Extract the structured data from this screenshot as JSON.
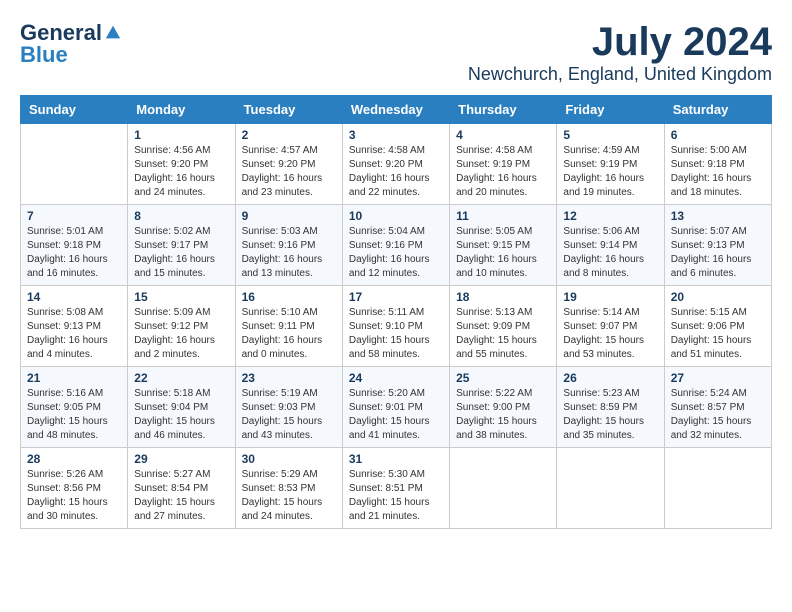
{
  "header": {
    "logo": {
      "general": "General",
      "blue": "Blue",
      "tagline": ""
    },
    "title": "July 2024",
    "location": "Newchurch, England, United Kingdom"
  },
  "calendar": {
    "weekdays": [
      "Sunday",
      "Monday",
      "Tuesday",
      "Wednesday",
      "Thursday",
      "Friday",
      "Saturday"
    ],
    "weeks": [
      [
        {
          "day": "",
          "sunrise": "",
          "sunset": "",
          "daylight": ""
        },
        {
          "day": "1",
          "sunrise": "Sunrise: 4:56 AM",
          "sunset": "Sunset: 9:20 PM",
          "daylight": "Daylight: 16 hours and 24 minutes."
        },
        {
          "day": "2",
          "sunrise": "Sunrise: 4:57 AM",
          "sunset": "Sunset: 9:20 PM",
          "daylight": "Daylight: 16 hours and 23 minutes."
        },
        {
          "day": "3",
          "sunrise": "Sunrise: 4:58 AM",
          "sunset": "Sunset: 9:20 PM",
          "daylight": "Daylight: 16 hours and 22 minutes."
        },
        {
          "day": "4",
          "sunrise": "Sunrise: 4:58 AM",
          "sunset": "Sunset: 9:19 PM",
          "daylight": "Daylight: 16 hours and 20 minutes."
        },
        {
          "day": "5",
          "sunrise": "Sunrise: 4:59 AM",
          "sunset": "Sunset: 9:19 PM",
          "daylight": "Daylight: 16 hours and 19 minutes."
        },
        {
          "day": "6",
          "sunrise": "Sunrise: 5:00 AM",
          "sunset": "Sunset: 9:18 PM",
          "daylight": "Daylight: 16 hours and 18 minutes."
        }
      ],
      [
        {
          "day": "7",
          "sunrise": "Sunrise: 5:01 AM",
          "sunset": "Sunset: 9:18 PM",
          "daylight": "Daylight: 16 hours and 16 minutes."
        },
        {
          "day": "8",
          "sunrise": "Sunrise: 5:02 AM",
          "sunset": "Sunset: 9:17 PM",
          "daylight": "Daylight: 16 hours and 15 minutes."
        },
        {
          "day": "9",
          "sunrise": "Sunrise: 5:03 AM",
          "sunset": "Sunset: 9:16 PM",
          "daylight": "Daylight: 16 hours and 13 minutes."
        },
        {
          "day": "10",
          "sunrise": "Sunrise: 5:04 AM",
          "sunset": "Sunset: 9:16 PM",
          "daylight": "Daylight: 16 hours and 12 minutes."
        },
        {
          "day": "11",
          "sunrise": "Sunrise: 5:05 AM",
          "sunset": "Sunset: 9:15 PM",
          "daylight": "Daylight: 16 hours and 10 minutes."
        },
        {
          "day": "12",
          "sunrise": "Sunrise: 5:06 AM",
          "sunset": "Sunset: 9:14 PM",
          "daylight": "Daylight: 16 hours and 8 minutes."
        },
        {
          "day": "13",
          "sunrise": "Sunrise: 5:07 AM",
          "sunset": "Sunset: 9:13 PM",
          "daylight": "Daylight: 16 hours and 6 minutes."
        }
      ],
      [
        {
          "day": "14",
          "sunrise": "Sunrise: 5:08 AM",
          "sunset": "Sunset: 9:13 PM",
          "daylight": "Daylight: 16 hours and 4 minutes."
        },
        {
          "day": "15",
          "sunrise": "Sunrise: 5:09 AM",
          "sunset": "Sunset: 9:12 PM",
          "daylight": "Daylight: 16 hours and 2 minutes."
        },
        {
          "day": "16",
          "sunrise": "Sunrise: 5:10 AM",
          "sunset": "Sunset: 9:11 PM",
          "daylight": "Daylight: 16 hours and 0 minutes."
        },
        {
          "day": "17",
          "sunrise": "Sunrise: 5:11 AM",
          "sunset": "Sunset: 9:10 PM",
          "daylight": "Daylight: 15 hours and 58 minutes."
        },
        {
          "day": "18",
          "sunrise": "Sunrise: 5:13 AM",
          "sunset": "Sunset: 9:09 PM",
          "daylight": "Daylight: 15 hours and 55 minutes."
        },
        {
          "day": "19",
          "sunrise": "Sunrise: 5:14 AM",
          "sunset": "Sunset: 9:07 PM",
          "daylight": "Daylight: 15 hours and 53 minutes."
        },
        {
          "day": "20",
          "sunrise": "Sunrise: 5:15 AM",
          "sunset": "Sunset: 9:06 PM",
          "daylight": "Daylight: 15 hours and 51 minutes."
        }
      ],
      [
        {
          "day": "21",
          "sunrise": "Sunrise: 5:16 AM",
          "sunset": "Sunset: 9:05 PM",
          "daylight": "Daylight: 15 hours and 48 minutes."
        },
        {
          "day": "22",
          "sunrise": "Sunrise: 5:18 AM",
          "sunset": "Sunset: 9:04 PM",
          "daylight": "Daylight: 15 hours and 46 minutes."
        },
        {
          "day": "23",
          "sunrise": "Sunrise: 5:19 AM",
          "sunset": "Sunset: 9:03 PM",
          "daylight": "Daylight: 15 hours and 43 minutes."
        },
        {
          "day": "24",
          "sunrise": "Sunrise: 5:20 AM",
          "sunset": "Sunset: 9:01 PM",
          "daylight": "Daylight: 15 hours and 41 minutes."
        },
        {
          "day": "25",
          "sunrise": "Sunrise: 5:22 AM",
          "sunset": "Sunset: 9:00 PM",
          "daylight": "Daylight: 15 hours and 38 minutes."
        },
        {
          "day": "26",
          "sunrise": "Sunrise: 5:23 AM",
          "sunset": "Sunset: 8:59 PM",
          "daylight": "Daylight: 15 hours and 35 minutes."
        },
        {
          "day": "27",
          "sunrise": "Sunrise: 5:24 AM",
          "sunset": "Sunset: 8:57 PM",
          "daylight": "Daylight: 15 hours and 32 minutes."
        }
      ],
      [
        {
          "day": "28",
          "sunrise": "Sunrise: 5:26 AM",
          "sunset": "Sunset: 8:56 PM",
          "daylight": "Daylight: 15 hours and 30 minutes."
        },
        {
          "day": "29",
          "sunrise": "Sunrise: 5:27 AM",
          "sunset": "Sunset: 8:54 PM",
          "daylight": "Daylight: 15 hours and 27 minutes."
        },
        {
          "day": "30",
          "sunrise": "Sunrise: 5:29 AM",
          "sunset": "Sunset: 8:53 PM",
          "daylight": "Daylight: 15 hours and 24 minutes."
        },
        {
          "day": "31",
          "sunrise": "Sunrise: 5:30 AM",
          "sunset": "Sunset: 8:51 PM",
          "daylight": "Daylight: 15 hours and 21 minutes."
        },
        {
          "day": "",
          "sunrise": "",
          "sunset": "",
          "daylight": ""
        },
        {
          "day": "",
          "sunrise": "",
          "sunset": "",
          "daylight": ""
        },
        {
          "day": "",
          "sunrise": "",
          "sunset": "",
          "daylight": ""
        }
      ]
    ]
  }
}
